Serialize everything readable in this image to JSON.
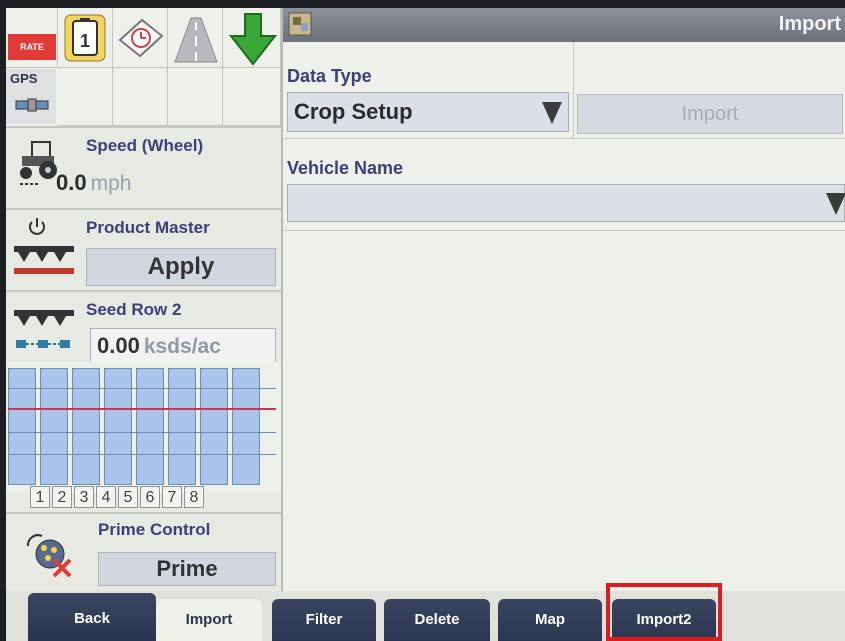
{
  "sidebar": {
    "status": {
      "rate_label": "RATE",
      "gps_label": "GPS",
      "icons": [
        "battery-icon",
        "clock-icon",
        "road-icon",
        "down-arrow-icon",
        "satellite-icon"
      ]
    },
    "speed": {
      "title": "Speed (Wheel)",
      "value": "0.0",
      "unit": "mph"
    },
    "product_master": {
      "title": "Product Master",
      "button": "Apply"
    },
    "seed_row": {
      "title": "Seed Row 2",
      "value": "0.00",
      "unit": "ksds/ac"
    },
    "rows": [
      "1",
      "2",
      "3",
      "4",
      "5",
      "6",
      "7",
      "8"
    ],
    "prime": {
      "title": "Prime Control",
      "button": "Prime"
    }
  },
  "header": {
    "title": "Import"
  },
  "form": {
    "data_type_label": "Data Type",
    "data_type_value": "Crop Setup",
    "import_button": "Import",
    "vehicle_name_label": "Vehicle Name",
    "vehicle_name_value": ""
  },
  "tabs": [
    {
      "label": "Back"
    },
    {
      "label": "Import"
    },
    {
      "label": "Filter"
    },
    {
      "label": "Delete"
    },
    {
      "label": "Map"
    },
    {
      "label": "Import2"
    }
  ],
  "colors": {
    "highlight": "#e01b1b",
    "accent_green": "#3aa637",
    "rate_red": "#e23a38"
  }
}
